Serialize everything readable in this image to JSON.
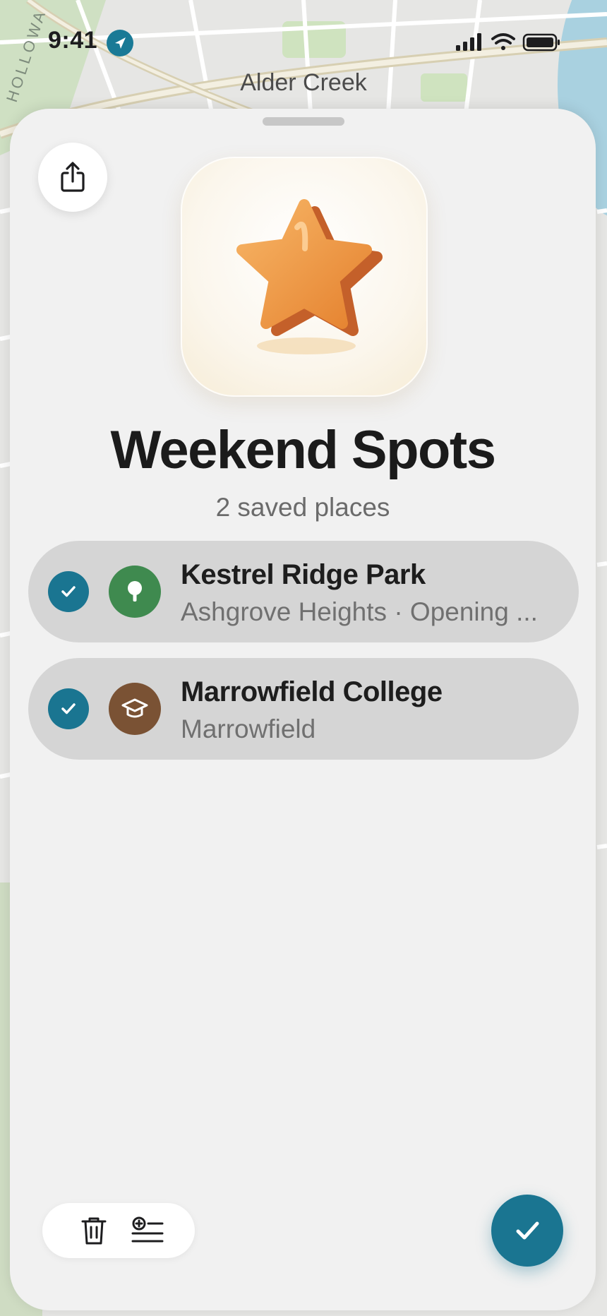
{
  "status_bar": {
    "time": "9:41"
  },
  "map": {
    "area_label": "Alder Creek",
    "road_label": "HOLLOWA"
  },
  "sheet": {
    "title": "Weekend Spots",
    "subtitle": "2 saved places",
    "hero_icon": "star-icon",
    "places": [
      {
        "name": "Kestrel Ridge Park",
        "detail": "Ashgrove Heights · Opening ...",
        "category_icon": "tree-icon",
        "category_color": "#3f8a4f",
        "selected": true
      },
      {
        "name": "Marrowfield College",
        "detail": "Marrowfield",
        "category_icon": "graduation-cap-icon",
        "category_color": "#7a5234",
        "selected": true
      }
    ]
  },
  "colors": {
    "accent": "#1a7591",
    "star": "#e8923d"
  }
}
